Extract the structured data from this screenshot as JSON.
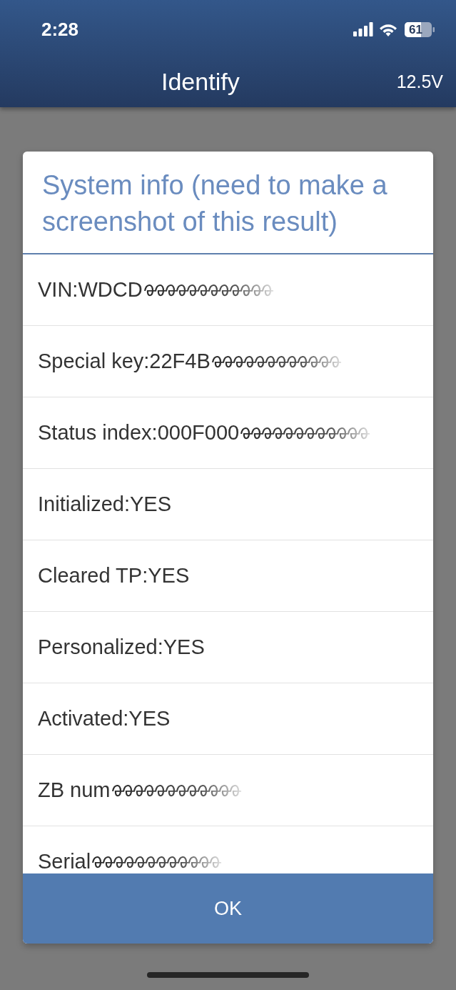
{
  "status_bar": {
    "time": "2:28",
    "battery": "61"
  },
  "header": {
    "title": "Identify",
    "voltage": "12.5V"
  },
  "dialog": {
    "title": "System info (need to make a screenshot of this result)",
    "rows": [
      {
        "text": "VIN:WDCD",
        "obscured": true
      },
      {
        "text": "Special key:22F4B",
        "obscured": true
      },
      {
        "text": "Status index:000F000",
        "obscured": true
      },
      {
        "text": "Initialized:YES",
        "obscured": false
      },
      {
        "text": "Cleared TP:YES",
        "obscured": false
      },
      {
        "text": "Personalized:YES",
        "obscured": false
      },
      {
        "text": "Activated:YES",
        "obscured": false
      },
      {
        "text": "ZB num",
        "obscured": true
      },
      {
        "text": "Serial",
        "obscured": true
      }
    ],
    "button": "OK"
  }
}
